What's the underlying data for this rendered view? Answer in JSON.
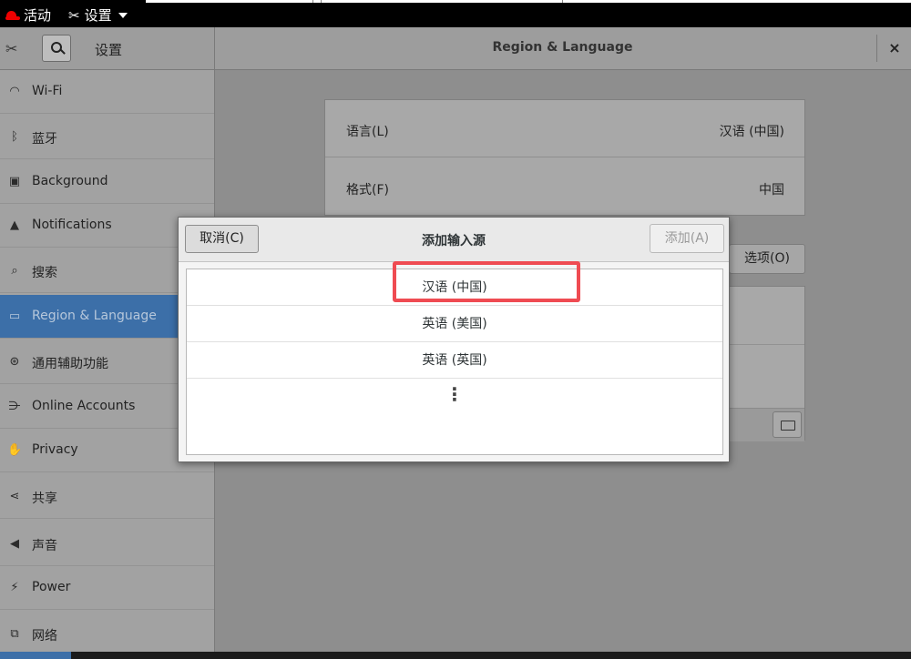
{
  "topbar": {
    "activities": "活动",
    "app_menu": "设置"
  },
  "header": {
    "left_title": "设置",
    "title": "Region & Language",
    "close": "×"
  },
  "sidebar": {
    "items": [
      {
        "label": "Wi-Fi",
        "icon": "wifi-icon"
      },
      {
        "label": "蓝牙",
        "icon": "bluetooth-icon"
      },
      {
        "label": "Background",
        "icon": "background-icon"
      },
      {
        "label": "Notifications",
        "icon": "bell-icon"
      },
      {
        "label": "搜索",
        "icon": "search-icon"
      },
      {
        "label": "Region & Language",
        "icon": "region-icon",
        "active": true
      },
      {
        "label": "通用辅助功能",
        "icon": "accessibility-icon"
      },
      {
        "label": "Online Accounts",
        "icon": "online-accounts-icon"
      },
      {
        "label": "Privacy",
        "icon": "hand-icon"
      },
      {
        "label": "共享",
        "icon": "share-icon"
      },
      {
        "label": "声音",
        "icon": "speaker-icon"
      },
      {
        "label": "Power",
        "icon": "power-icon"
      },
      {
        "label": "网络",
        "icon": "network-icon"
      }
    ]
  },
  "main": {
    "language_label": "语言(L)",
    "language_value": "汉语 (中国)",
    "format_label": "格式(F)",
    "format_value": "中国",
    "options_button": "选项(O)"
  },
  "dialog": {
    "title": "添加输入源",
    "cancel": "取消(C)",
    "add": "添加(A)",
    "items": [
      "汉语 (中国)",
      "英语 (美国)",
      "英语 (英国)"
    ],
    "more": "⋮"
  },
  "colors": {
    "accent": "#3c6fa8",
    "highlight": "#ef4b52"
  }
}
